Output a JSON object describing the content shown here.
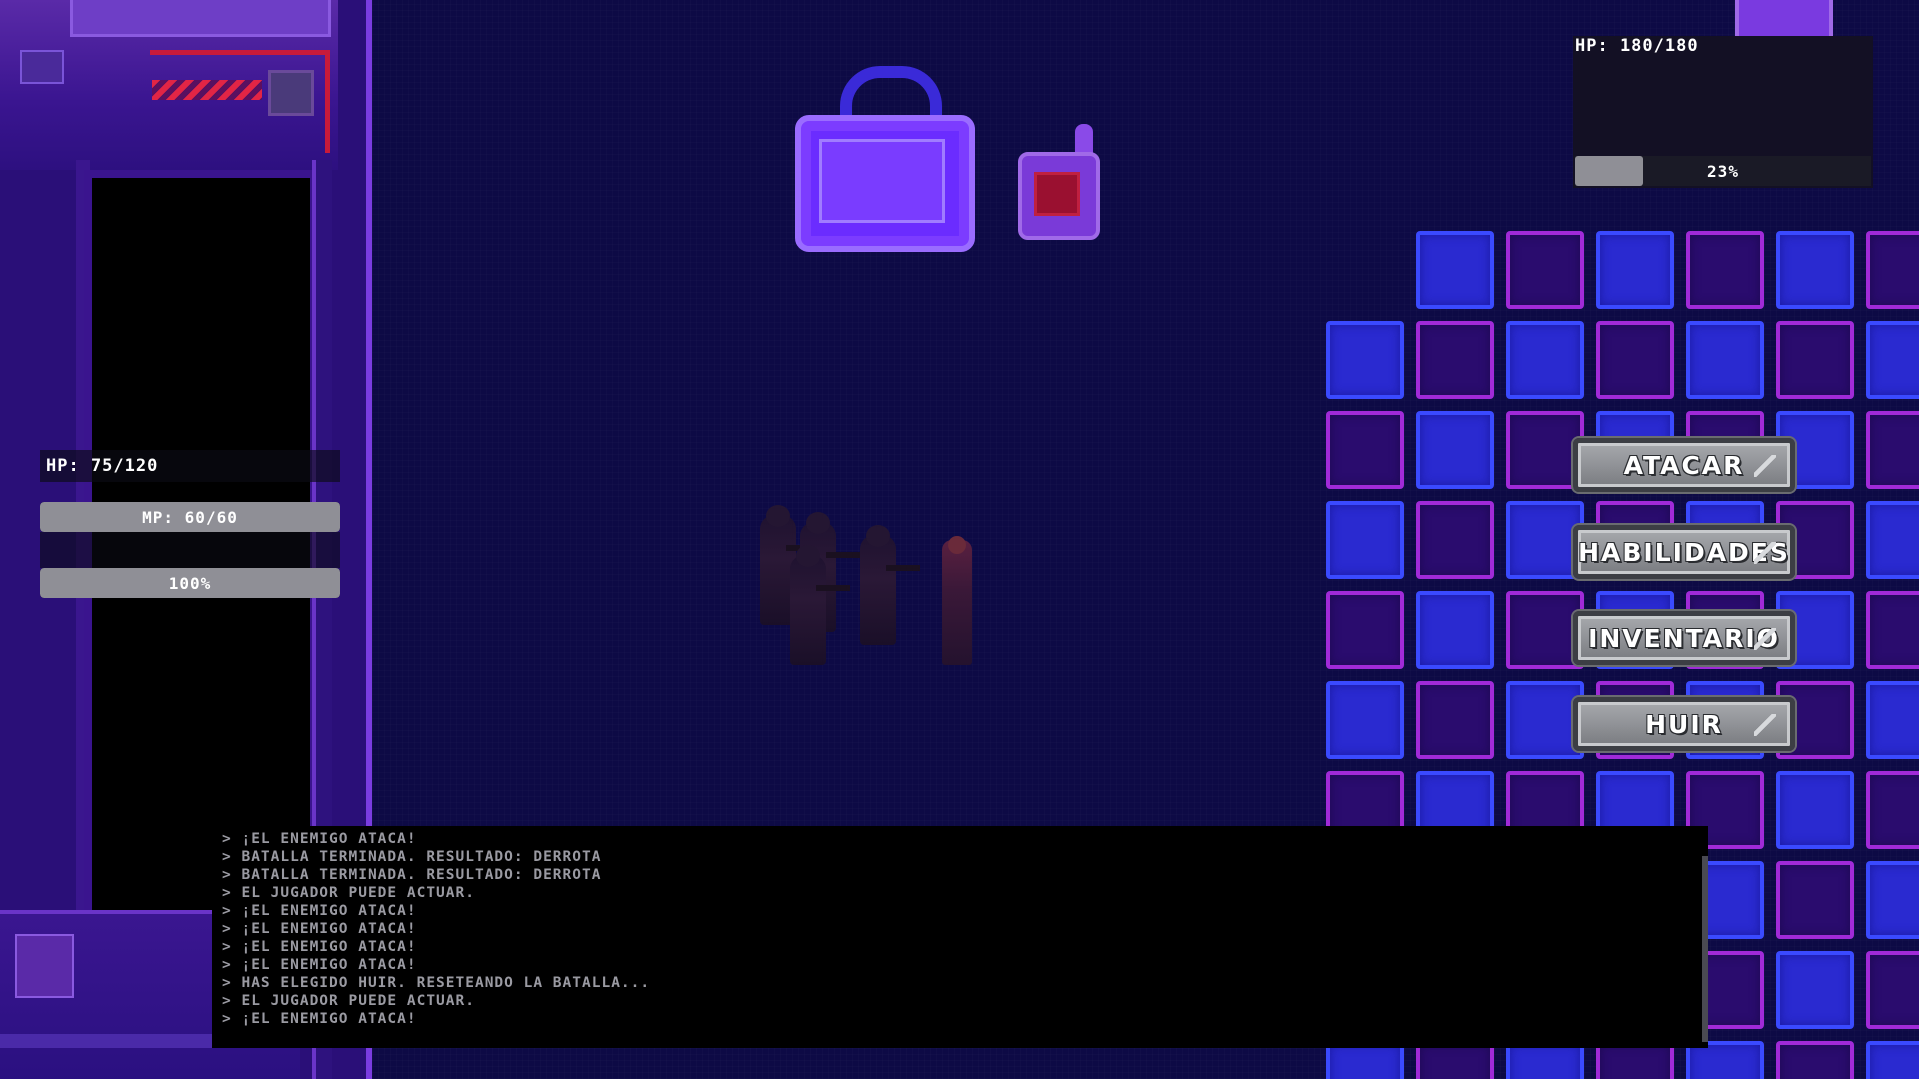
{
  "player": {
    "hp_text": "HP: 75/120",
    "mp_text": "MP: 60/60",
    "mp_fill": 1.0,
    "charge_text": "100%",
    "charge_fill": 1.0
  },
  "enemy": {
    "hp_text": "HP: 180/180",
    "charge_text": "23%",
    "charge_fill": 0.23
  },
  "menu": {
    "attack": "ATACAR",
    "skills": "HABILIDADES",
    "inventory": "INVENTARIO",
    "flee": "HUIR"
  },
  "log": [
    "> ¡EL ENEMIGO ATACA!",
    "> BATALLA TERMINADA. RESULTADO: DERROTA",
    "> BATALLA TERMINADA. RESULTADO: DERROTA",
    "> EL JUGADOR PUEDE ACTUAR.",
    "> ¡EL ENEMIGO ATACA!",
    "> ¡EL ENEMIGO ATACA!",
    "> ¡EL ENEMIGO ATACA!",
    "> ¡EL ENEMIGO ATACA!",
    "> HAS ELEGIDO HUIR. RESETEANDO LA BATALLA...",
    "> EL JUGADOR PUEDE ACTUAR.",
    "> ¡EL ENEMIGO ATACA!"
  ],
  "colors": {
    "tile_blue": "#2a2ad0",
    "tile_purple": "#2a0c6e",
    "bar_fill": "#8f8f96"
  }
}
